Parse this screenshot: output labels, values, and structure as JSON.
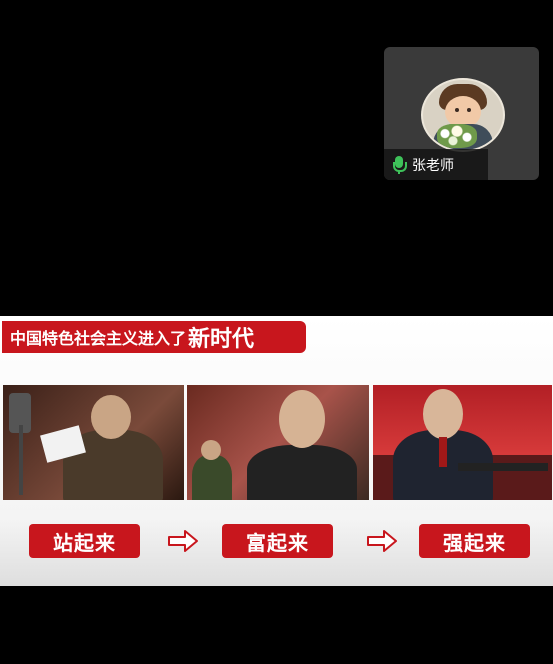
{
  "participant": {
    "name": "张老师",
    "mic_status": "on"
  },
  "slide": {
    "title_part1": "中国特色社会主义进入了",
    "title_part2": "新时代",
    "stages": [
      {
        "label": "站起来"
      },
      {
        "label": "富起来"
      },
      {
        "label": "强起来"
      }
    ],
    "accent_color": "#c8161d"
  }
}
